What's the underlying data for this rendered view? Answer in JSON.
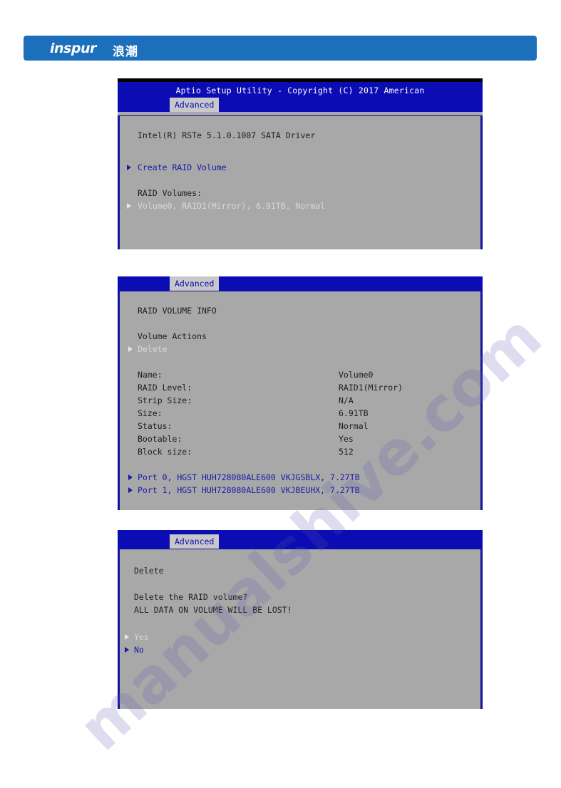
{
  "header": {
    "logo_text": "inspur",
    "logo_cn": "浪潮",
    "brand_color": "#1c6fba"
  },
  "watermark": {
    "text": "manualshive.com"
  },
  "bios": {
    "title": "Aptio Setup Utility - Copyright (C) 2017 American",
    "tab_label": "Advanced",
    "colors": {
      "header_blue": "#0c0cb4",
      "body_gray": "#a8a8a8",
      "link_blue": "#1a1aa8",
      "highlight": "#d8d8d8"
    }
  },
  "panel1": {
    "driver_line": "Intel(R) RSTe 5.1.0.1007 SATA Driver",
    "create_item": "Create RAID Volume",
    "volumes_heading": "RAID Volumes:",
    "volume_item": "Volume0, RAID1(Mirror), 6.91TB, Normal"
  },
  "panel2": {
    "heading": "RAID VOLUME INFO",
    "actions_heading": "Volume Actions",
    "delete_item": "Delete",
    "fields": [
      {
        "label": "Name:",
        "value": "Volume0"
      },
      {
        "label": "RAID Level:",
        "value": "RAID1(Mirror)"
      },
      {
        "label": "Strip Size:",
        "value": "N/A"
      },
      {
        "label": "Size:",
        "value": "6.91TB"
      },
      {
        "label": "Status:",
        "value": "Normal"
      },
      {
        "label": "Bootable:",
        "value": "Yes"
      },
      {
        "label": "Block size:",
        "value": "512"
      }
    ],
    "disks": [
      "Port 0, HGST HUH728080ALE600 VKJGSBLX, 7.27TB",
      "Port 1, HGST HUH728080ALE600 VKJBEUHX, 7.27TB"
    ]
  },
  "panel3": {
    "heading": "Delete",
    "question": "Delete the RAID volume?",
    "warning": "ALL DATA ON VOLUME WILL BE LOST!",
    "yes_label": "Yes",
    "no_label": "No"
  }
}
